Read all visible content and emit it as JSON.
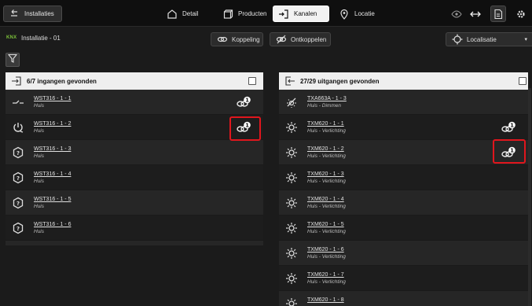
{
  "toolbar": {
    "installaties_label": "Installaties",
    "detail_label": "Detail",
    "producten_label": "Producten",
    "kanalen_label": "Kanalen",
    "locatie_label": "Locatie"
  },
  "installation": {
    "brand": "KNX",
    "name": "Installatie - 01",
    "koppeling_label": "Koppeling",
    "ontkoppelen_label": "Ontkoppelen",
    "localisatie_label": "Localisatie"
  },
  "inputs_panel": {
    "title": "6/7 ingangen gevonden",
    "rows": [
      {
        "name": "WST316 - 1 - 1",
        "sub": "Huis",
        "icon": "switch-icon",
        "linked": true
      },
      {
        "name": "WST316 - 1 - 2",
        "sub": "Huis",
        "icon": "power-icon",
        "linked": true
      },
      {
        "name": "WST316 - 1 - 3",
        "sub": "Huis",
        "icon": "question-icon",
        "linked": false
      },
      {
        "name": "WST316 - 1 - 4",
        "sub": "Huis",
        "icon": "question-icon",
        "linked": false
      },
      {
        "name": "WST316 - 1 - 5",
        "sub": "Huis",
        "icon": "question-icon",
        "linked": false
      },
      {
        "name": "WST316 - 1 - 6",
        "sub": "Huis",
        "icon": "question-icon",
        "linked": false
      }
    ]
  },
  "outputs_panel": {
    "title": "27/29 uitgangen gevonden",
    "rows": [
      {
        "name": "TXA663A - 1 - 3",
        "sub": "Huis - Dimmen",
        "icon": "dimmer-icon",
        "linked": false
      },
      {
        "name": "TXM620 - 1 - 1",
        "sub": "Huis - Verlichting",
        "icon": "light-icon",
        "linked": true
      },
      {
        "name": "TXM620 - 1 - 2",
        "sub": "Huis - Verlichting",
        "icon": "light-icon",
        "linked": true
      },
      {
        "name": "TXM620 - 1 - 3",
        "sub": "Huis - Verlichting",
        "icon": "light-icon",
        "linked": false
      },
      {
        "name": "TXM620 - 1 - 4",
        "sub": "Huis - Verlichting",
        "icon": "light-icon",
        "linked": false
      },
      {
        "name": "TXM620 - 1 - 5",
        "sub": "Huis - Verlichting",
        "icon": "light-icon",
        "linked": false
      },
      {
        "name": "TXM620 - 1 - 6",
        "sub": "Huis - Verlichting",
        "icon": "light-icon",
        "linked": false
      },
      {
        "name": "TXM620 - 1 - 7",
        "sub": "Huis - Verlichting",
        "icon": "light-icon",
        "linked": false
      },
      {
        "name": "TXM620 - 1 - 8",
        "sub": "",
        "icon": "light-icon",
        "linked": false
      }
    ]
  },
  "colors": {
    "highlight": "#e0161d",
    "knx_green": "#7cc13a",
    "active_tab_bg": "#f2f2f2"
  }
}
